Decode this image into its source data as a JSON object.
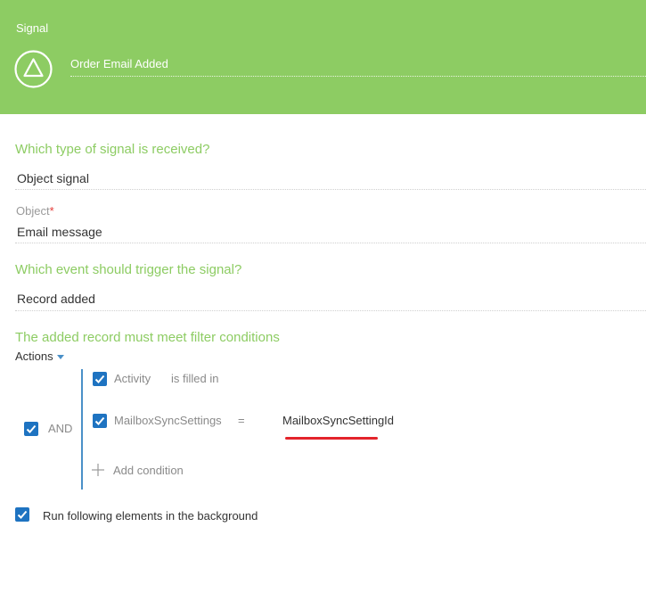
{
  "header": {
    "title": "Signal",
    "element_name": "Order Email Added",
    "icon": "triangle-signal-icon",
    "bg_color": "#8dcc63"
  },
  "signal_type": {
    "question": "Which type of signal is received?",
    "value": "Object signal"
  },
  "object": {
    "label": "Object",
    "required_mark": "*",
    "value": "Email message"
  },
  "event": {
    "question": "Which event should trigger the signal?",
    "value": "Record added"
  },
  "filter": {
    "heading": "The added record must meet filter conditions",
    "actions_label": "Actions",
    "group_operator": "AND",
    "conditions": [
      {
        "column": "Activity",
        "operator": "is filled in",
        "value": ""
      },
      {
        "column": "MailboxSyncSettings",
        "operator": "=",
        "value": "MailboxSyncSettingId"
      }
    ],
    "add_condition_label": "Add condition"
  },
  "options": {
    "run_background_label": "Run following elements in the background",
    "run_background_checked": true
  },
  "colors": {
    "accent_green": "#8dcc63",
    "checkbox_blue": "#1e73c1",
    "highlight_red": "#e3242b"
  }
}
